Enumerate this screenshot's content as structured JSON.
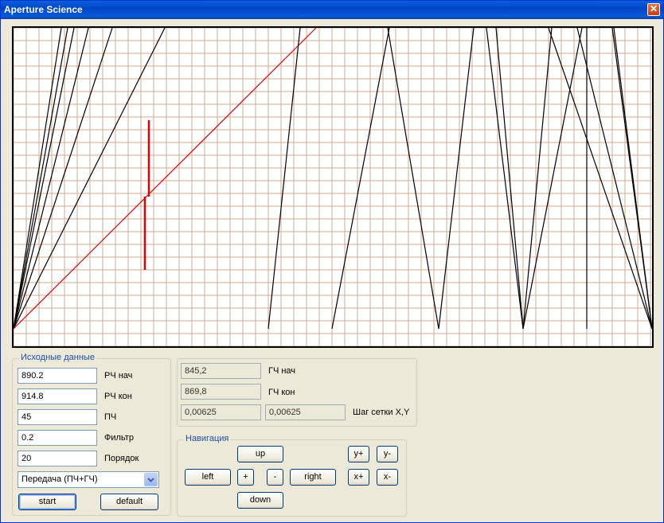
{
  "window": {
    "title": "Aperture Science",
    "close_icon": "close-icon"
  },
  "colors": {
    "grid": "#c8ae96",
    "trace": "#000000",
    "accent": "#e00000",
    "plot_bg": "#ffffff"
  },
  "source_group": {
    "title": "Исходные данные",
    "fields": [
      {
        "value": "890.2",
        "label": "РЧ нач"
      },
      {
        "value": "914.8",
        "label": "РЧ кон"
      },
      {
        "value": "45",
        "label": "ПЧ"
      },
      {
        "value": "0.2",
        "label": "Фильтр"
      },
      {
        "value": "20",
        "label": "Порядок"
      }
    ],
    "mode_select": "Передача (ПЧ+ГЧ)",
    "start_label": "start",
    "default_label": "default"
  },
  "results": {
    "gch_start": "845,2",
    "gch_start_label": "ГЧ нач",
    "gch_end": "869,8",
    "gch_end_label": "ГЧ кон",
    "step_x": "0,00625",
    "step_y": "0,00625",
    "step_label": "Шаг сетки X,Y"
  },
  "navigation": {
    "title": "Навигация",
    "up": "up",
    "down": "down",
    "left": "left",
    "right": "right",
    "zoom_in": "+",
    "zoom_out": "-",
    "y_plus": "y+",
    "y_minus": "y-",
    "x_plus": "x+",
    "x_minus": "x-"
  }
}
